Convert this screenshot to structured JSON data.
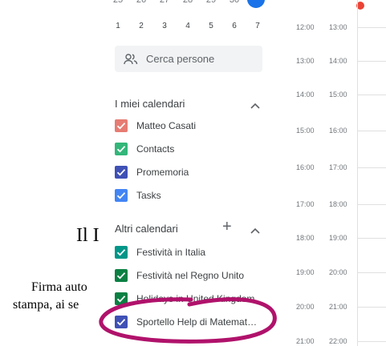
{
  "mini_calendar": {
    "top_row": [
      "25",
      "26",
      "27",
      "28",
      "29",
      "30",
      "31"
    ],
    "dates": [
      "1",
      "2",
      "3",
      "4",
      "5",
      "6",
      "7"
    ]
  },
  "search": {
    "label": "Cerca persone",
    "icon": "people-icon"
  },
  "my_calendars": {
    "title": "I miei calendari",
    "items": [
      {
        "label": "Matteo Casati",
        "color": "#e67c73"
      },
      {
        "label": "Contacts",
        "color": "#33b679"
      },
      {
        "label": "Promemoria",
        "color": "#3f51b5"
      },
      {
        "label": "Tasks",
        "color": "#4285f4"
      }
    ]
  },
  "other_calendars": {
    "title": "Altri calendari",
    "items": [
      {
        "label": "Festività in Italia",
        "color": "#009688"
      },
      {
        "label": "Festività nel Regno Unito",
        "color": "#0b8043"
      },
      {
        "label": "Holidays in United Kingdom",
        "color": "#0b8043"
      },
      {
        "label": "Sportello Help di Matemat…",
        "color": "#3f51b5"
      }
    ]
  },
  "time_grid": {
    "rows": [
      {
        "a": "12:00",
        "b": "13:00"
      },
      {
        "a": "13:00",
        "b": "14:00"
      },
      {
        "a": "14:00",
        "b": "15:00"
      },
      {
        "a": "15:00",
        "b": "16:00"
      },
      {
        "a": "16:00",
        "b": "17:00"
      },
      {
        "a": "17:00",
        "b": "18:00"
      },
      {
        "a": "18:00",
        "b": "19:00"
      },
      {
        "a": "19:00",
        "b": "20:00"
      },
      {
        "a": "20:00",
        "b": "21:00"
      },
      {
        "a": "21:00",
        "b": "22:00"
      }
    ]
  },
  "background_doc": {
    "heading": "Il I",
    "line1": "Firma auto",
    "line2": "stampa, ai se"
  },
  "colors": {
    "today": "#1a73e8",
    "current_time": "#ea4335",
    "annotation": "#b0126b"
  }
}
